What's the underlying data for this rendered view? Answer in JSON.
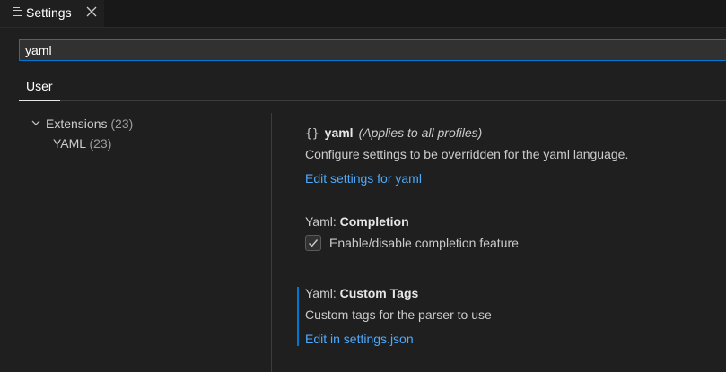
{
  "tab": {
    "label": "Settings"
  },
  "search": {
    "value": "yaml"
  },
  "scope_tabs": [
    "User"
  ],
  "toc": {
    "group": {
      "label": "Extensions",
      "count": "(23)"
    },
    "item": {
      "label": "YAML",
      "count": "(23)"
    }
  },
  "language_section": {
    "braces": "{}",
    "name": "yaml",
    "profile_note": "(Applies to all profiles)",
    "description": "Configure settings to be overridden for the yaml language.",
    "link": "Edit settings for yaml"
  },
  "settings": {
    "completion": {
      "category": "Yaml:",
      "name": "Completion",
      "checkbox_label": "Enable/disable completion feature",
      "checked": true
    },
    "custom_tags": {
      "category": "Yaml:",
      "name": "Custom Tags",
      "description": "Custom tags for the parser to use",
      "link": "Edit in settings.json"
    }
  },
  "colors": {
    "accent": "#0078d4",
    "link": "#4daafc",
    "background": "#1f1f1f"
  },
  "icons": {
    "tab_icon": "settings-file-icon",
    "close": "close-icon",
    "chevron": "chevron-down-icon",
    "check": "check-icon"
  }
}
